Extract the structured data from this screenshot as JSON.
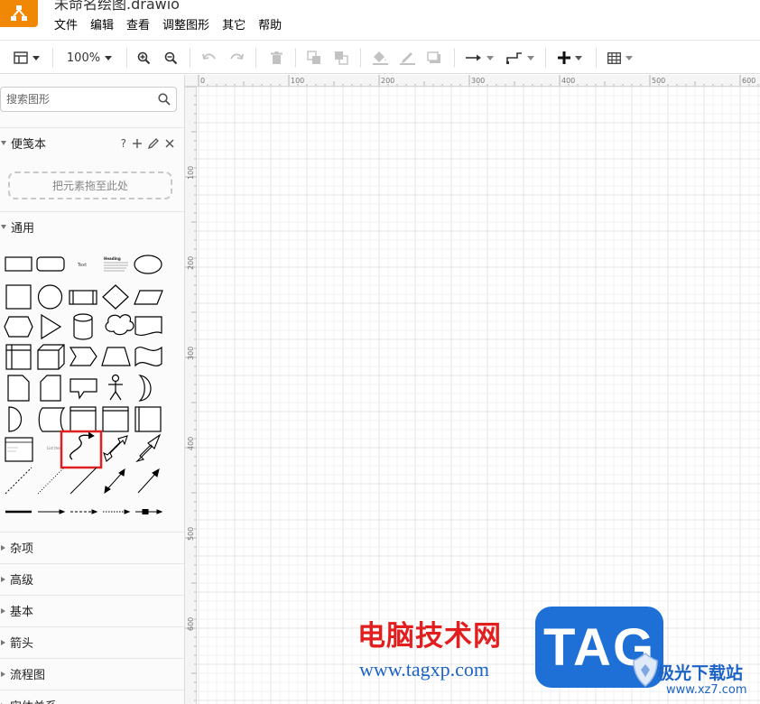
{
  "window": {
    "title": "未命名绘图.drawio"
  },
  "menu": [
    "文件",
    "编辑",
    "查看",
    "调整图形",
    "其它",
    "帮助"
  ],
  "toolbar": {
    "zoom": "100%",
    "icons": [
      "format-panel-icon",
      "zoom-in-icon",
      "zoom-out-icon",
      "undo-icon",
      "redo-icon",
      "delete-icon",
      "to-front-icon",
      "to-back-icon",
      "fill-color-icon",
      "line-color-icon",
      "shadow-icon",
      "connection-icon",
      "waypoints-icon",
      "insert-icon",
      "table-icon"
    ]
  },
  "sidebar": {
    "search": {
      "placeholder": "搜索图形"
    },
    "scratchpad": {
      "title": "便笺本",
      "help": "?",
      "drop_hint": "把元素拖至此处"
    },
    "general": {
      "title": "通用"
    },
    "shape_labels": {
      "text": "Text",
      "heading": "Heading",
      "list_item": "List Item"
    },
    "sections": [
      "杂项",
      "高级",
      "基本",
      "箭头",
      "流程图",
      "实体关系"
    ]
  },
  "canvas": {
    "ruler_top": [
      "0",
      "100",
      "200",
      "300",
      "400",
      "500",
      "600"
    ],
    "ruler_left": [
      "100",
      "200",
      "300",
      "400",
      "500",
      "600"
    ]
  },
  "watermark": {
    "cn": "电脑技术网",
    "url": "www.tagxp.com",
    "badge": "TAG",
    "site_cn": "极光下载站",
    "site_url": "www.xz7.com"
  },
  "colors": {
    "accent": "#f08705",
    "highlight": "#e02020",
    "watermark_red": "#e21e1e",
    "watermark_blue": "#1e6fd6"
  }
}
